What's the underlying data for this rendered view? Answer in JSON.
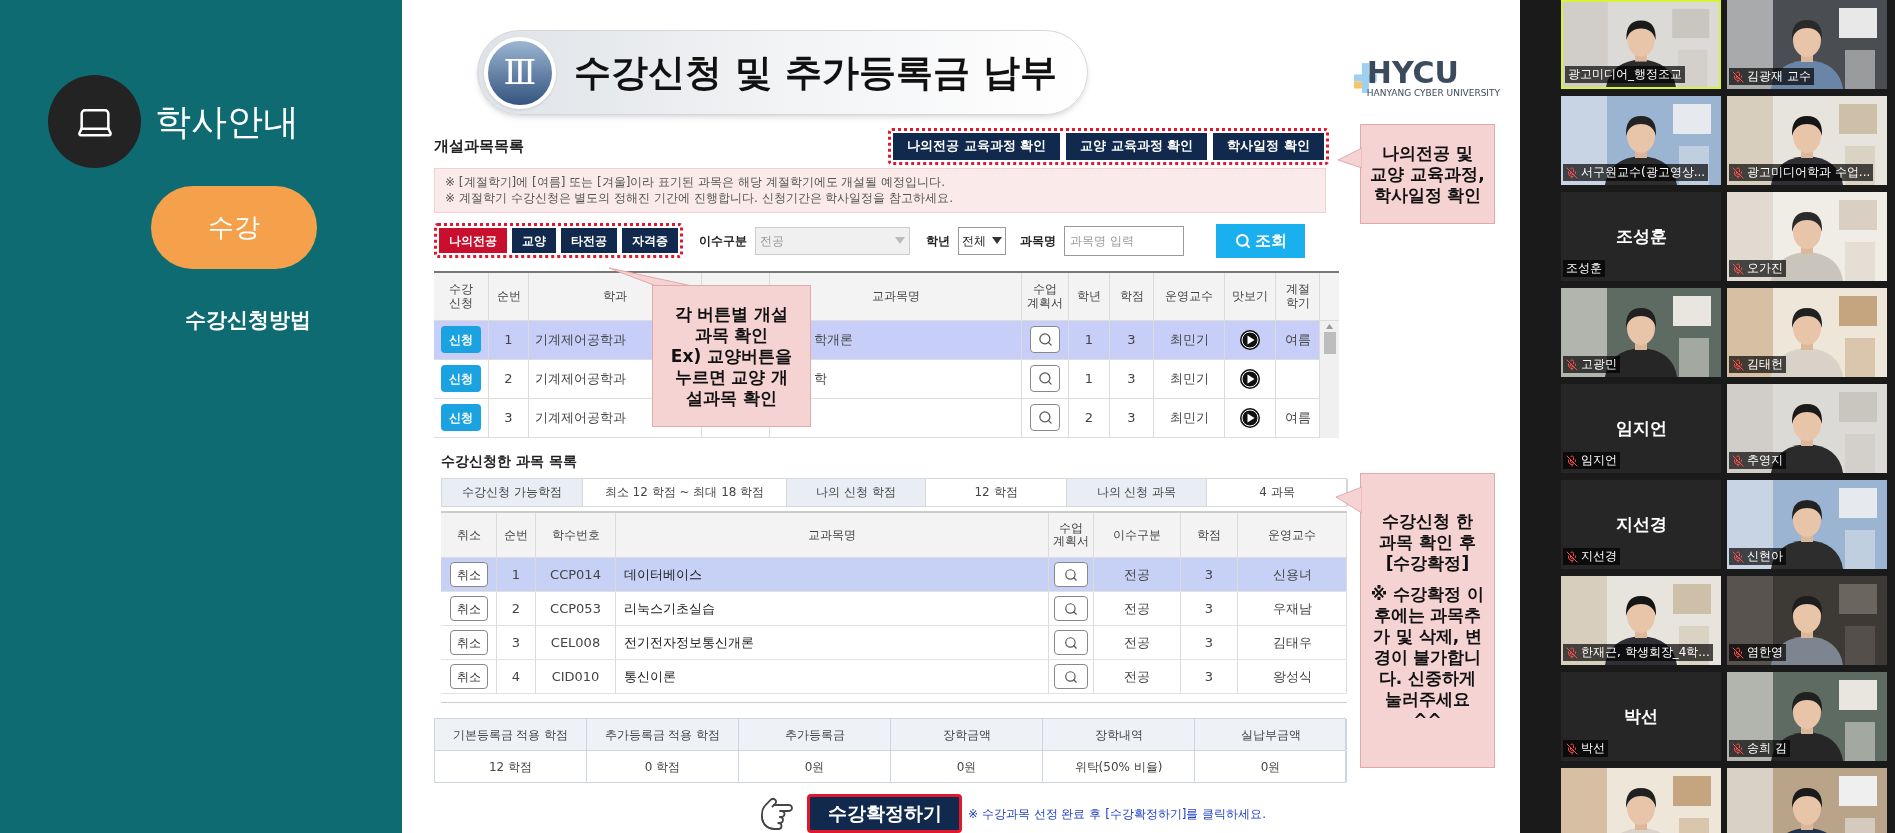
{
  "sidebar": {
    "section_title": "학사안내",
    "category": "수강",
    "page": "수강신청방법"
  },
  "slide": {
    "numeral": "Ⅲ",
    "title": "수강신청 및 추가등록금 납부",
    "logo": {
      "text": "HYCU",
      "subtitle": "HANYANG CYBER UNIVERSITY"
    },
    "list_title": "개설과목목록",
    "top_buttons": [
      "나의전공 교육과정 확인",
      "교양 교육과정 확인",
      "학사일정 확인"
    ],
    "callout_links": "나의전공 및\n교양 교육과정,\n학사일정 확인",
    "notice": [
      "※ [계절학기]에 [여름] 또는 [겨울]이라 표기된 과목은 해당 계절학기에도 개설될 예정입니다.",
      "※ 계절학기 수강신청은 별도의 정해진 기간에 진행합니다. 신청기간은 학사일정을 참고하세요."
    ],
    "tabs": [
      {
        "label": "나의전공",
        "selected": true
      },
      {
        "label": "교양",
        "selected": false
      },
      {
        "label": "타전공",
        "selected": false
      },
      {
        "label": "자격증",
        "selected": false
      }
    ],
    "filters": {
      "type_label": "이수구분",
      "type_value": "전공",
      "type_disabled": true,
      "year_label": "학년",
      "year_value": "전체",
      "name_label": "과목명",
      "name_placeholder": "과목명 입력",
      "search_button": "조회"
    },
    "courses": {
      "columns": [
        "수강\n신청",
        "순번",
        "학과",
        "교과목명",
        "수업\n계획서",
        "학년",
        "학점",
        "운영교수",
        "맛보기",
        "계절\n학기"
      ],
      "rows": [
        {
          "selected": true,
          "button": "신청",
          "no": "1",
          "dept": "기계제어공학과",
          "name": "학개론",
          "year": "1",
          "credit": "3",
          "professor": "최민기",
          "season": "여름"
        },
        {
          "selected": false,
          "button": "신청",
          "no": "2",
          "dept": "기계제어공학과",
          "name": "학",
          "year": "1",
          "credit": "3",
          "professor": "최민기"
        },
        {
          "selected": false,
          "button": "신청",
          "no": "3",
          "dept": "기계제어공학과",
          "year": "2",
          "credit": "3",
          "professor": "최민기",
          "season": "여름"
        }
      ]
    },
    "callout_tabs": "각 버튼별 개설\n과목 확인\nEx) 교양버튼을\n누르면 교양 개\n설과목 확인",
    "registered": {
      "title": "수강신청한 과목 목록",
      "summary": [
        {
          "label": "수강신청 가능학점",
          "value": "최소 12 학점 ~ 최대 18 학점"
        },
        {
          "label": "나의 신청 학점",
          "value": "12 학점"
        },
        {
          "label": "나의 신청 과목",
          "value": "4 과목"
        }
      ],
      "columns": [
        "취소",
        "순번",
        "학수번호",
        "교과목명",
        "수업\n계획서",
        "이수구분",
        "학점",
        "운영교수"
      ],
      "rows": [
        {
          "selected": true,
          "button": "취소",
          "no": "1",
          "code": "CCP014",
          "name": "데이터베이스",
          "type": "전공",
          "credit": "3",
          "professor": "신용녀"
        },
        {
          "selected": false,
          "button": "취소",
          "no": "2",
          "code": "CCP053",
          "name": "리눅스기초실습",
          "type": "전공",
          "credit": "3",
          "professor": "우재남"
        },
        {
          "selected": false,
          "button": "취소",
          "no": "3",
          "code": "CEL008",
          "name": "전기전자정보통신개론",
          "type": "전공",
          "credit": "3",
          "professor": "김태우"
        },
        {
          "selected": false,
          "button": "취소",
          "no": "4",
          "code": "CID010",
          "name": "통신이론",
          "type": "전공",
          "credit": "3",
          "professor": "왕성식"
        }
      ]
    },
    "callout_confirm": [
      "수강신청 한\n과목 확인 후\n[수강확정]",
      "※ 수강확정 이\n후에는 과목추\n가 및 삭제, 변\n경이 불가합니\n다. 신중하게\n눌러주세요\n^^"
    ],
    "fees": {
      "columns": [
        "기본등록금 적용 학점",
        "추가등록금 적용 학점",
        "추가등록금",
        "장학금액",
        "장학내역",
        "실납부금액"
      ],
      "values": [
        "12 학점",
        "0 학점",
        "0원",
        "0원",
        "위탁(50% 비율)",
        "0원"
      ]
    },
    "confirm": {
      "button": "수강확정하기",
      "note": "※ 수강과목 선정 완료 후 [수강확정하기]를 클릭하세요."
    }
  },
  "participants": [
    {
      "kind": "video",
      "name": "광고미디어_행정조교",
      "muted": false,
      "speaking": true
    },
    {
      "kind": "video",
      "name": "김광재 교수",
      "muted": true,
      "speaking": false
    },
    {
      "kind": "video",
      "name": "서구원교수(광고영상...",
      "muted": true,
      "speaking": false
    },
    {
      "kind": "video",
      "name": "광고미디어학과 수업...",
      "muted": true,
      "speaking": false
    },
    {
      "kind": "name",
      "display_name": "조성훈",
      "name": "조성훈",
      "muted": false,
      "speaking": false
    },
    {
      "kind": "video",
      "name": "오가진",
      "muted": true,
      "speaking": false
    },
    {
      "kind": "video",
      "name": "고광민",
      "muted": true,
      "speaking": false
    },
    {
      "kind": "video",
      "name": "김태헌",
      "muted": true,
      "speaking": false
    },
    {
      "kind": "name",
      "display_name": "임지언",
      "name": "임지언",
      "muted": true,
      "speaking": false
    },
    {
      "kind": "video",
      "name": "추영지",
      "muted": true,
      "speaking": false
    },
    {
      "kind": "name",
      "display_name": "지선경",
      "name": "지선경",
      "muted": true,
      "speaking": false
    },
    {
      "kind": "video",
      "name": "신현아",
      "muted": true,
      "speaking": false
    },
    {
      "kind": "video",
      "name": "한재근, 학생회장_4학...",
      "muted": true,
      "speaking": false
    },
    {
      "kind": "video",
      "name": "염한영",
      "muted": true,
      "speaking": false
    },
    {
      "kind": "name",
      "display_name": "박선",
      "name": "박선",
      "muted": true,
      "speaking": false
    },
    {
      "kind": "video",
      "name": "송희 김",
      "muted": true,
      "speaking": false
    },
    {
      "kind": "video"
    },
    {
      "kind": "video"
    }
  ]
}
